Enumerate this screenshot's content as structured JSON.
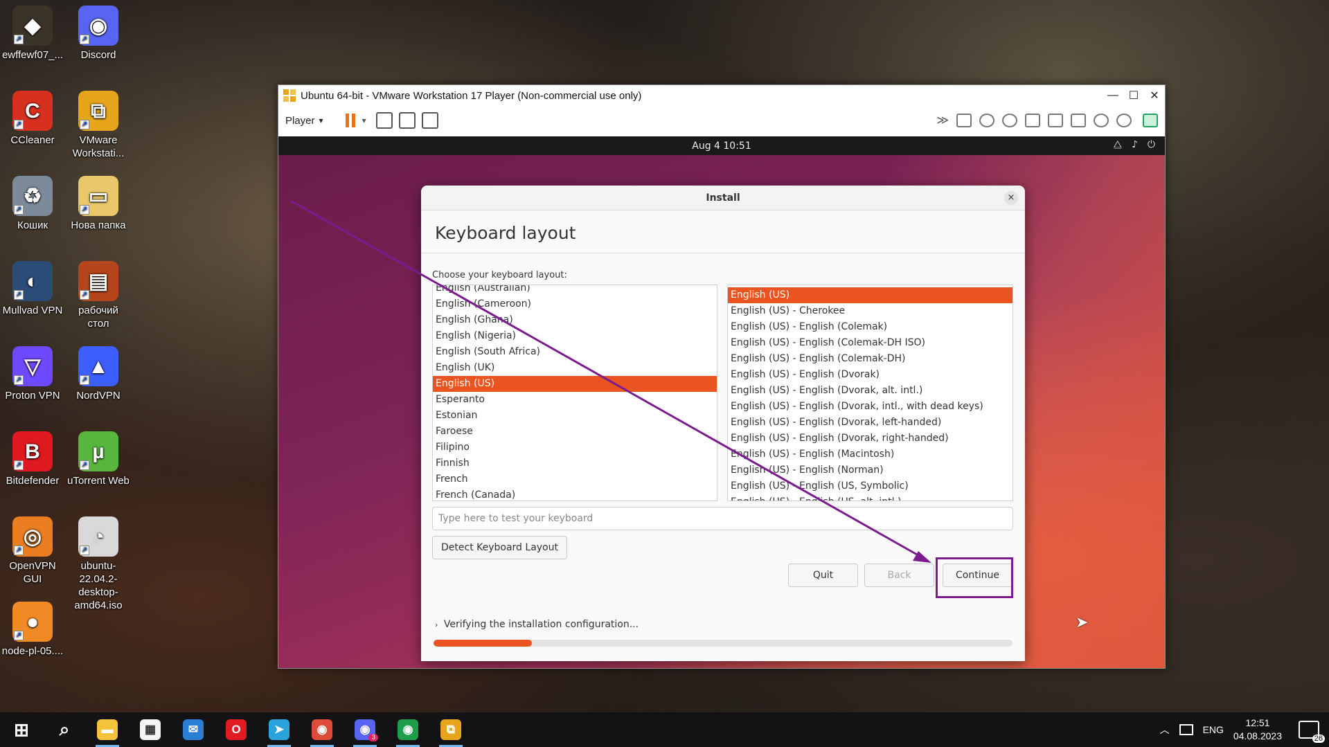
{
  "desktop": {
    "icons": [
      {
        "label": "ewffewf07_...",
        "glyph": "◆",
        "color": "#3a3328"
      },
      {
        "label": "Discord",
        "glyph": "◉",
        "color": "#5865f2"
      },
      {
        "label": "CCleaner",
        "glyph": "C",
        "color": "#d8301f"
      },
      {
        "label": "VMware Workstati...",
        "glyph": "⧉",
        "color": "#e7a51b"
      },
      {
        "label": "Кошик",
        "glyph": "♻",
        "color": "#7d8a99"
      },
      {
        "label": "Нова папка",
        "glyph": "▭",
        "color": "#e8c86a"
      },
      {
        "label": "Mullvad VPN",
        "glyph": "◐",
        "color": "#2b4b78"
      },
      {
        "label": "рабочий стол",
        "glyph": "▤",
        "color": "#b5451b"
      },
      {
        "label": "Proton VPN",
        "glyph": "▽",
        "color": "#6d4aff"
      },
      {
        "label": "NordVPN",
        "glyph": "▲",
        "color": "#3e5fff"
      },
      {
        "label": "Bitdefender",
        "glyph": "B",
        "color": "#e0181f"
      },
      {
        "label": "uTorrent Web",
        "glyph": "µ",
        "color": "#58b63e"
      },
      {
        "label": "OpenVPN GUI",
        "glyph": "◎",
        "color": "#ea7e20"
      },
      {
        "label": "ubuntu-22.04.2-desktop-amd64.iso",
        "glyph": "◔",
        "color": "#d9d9d9"
      },
      {
        "label": "node-pl-05....",
        "glyph": "●",
        "color": "#f08a24"
      }
    ]
  },
  "vmware": {
    "title": "Ubuntu 64-bit - VMware Workstation 17 Player (Non-commercial use only)",
    "minimize": "—",
    "maximize": "☐",
    "close": "✕",
    "player_label": "Player",
    "dropdown": "▾",
    "fast_forward": "≫"
  },
  "ubuntu": {
    "clock": "Aug 4  10:51",
    "tray": {
      "network": "⧋",
      "volume": "♪",
      "power": "⏻"
    }
  },
  "install": {
    "header": "Install",
    "close": "×",
    "title": "Keyboard layout",
    "choose_label": "Choose your keyboard layout:",
    "languages": [
      "English (Australian)",
      "English (Cameroon)",
      "English (Ghana)",
      "English (Nigeria)",
      "English (South Africa)",
      "English (UK)",
      "English (US)",
      "Esperanto",
      "Estonian",
      "Faroese",
      "Filipino",
      "Finnish",
      "French",
      "French (Canada)"
    ],
    "selected_language": "English (US)",
    "variants": [
      "English (US)",
      "English (US) - Cherokee",
      "English (US) - English (Colemak)",
      "English (US) - English (Colemak-DH ISO)",
      "English (US) - English (Colemak-DH)",
      "English (US) - English (Dvorak)",
      "English (US) - English (Dvorak, alt. intl.)",
      "English (US) - English (Dvorak, intl., with dead keys)",
      "English (US) - English (Dvorak, left-handed)",
      "English (US) - English (Dvorak, right-handed)",
      "English (US) - English (Macintosh)",
      "English (US) - English (Norman)",
      "English (US) - English (US, Symbolic)",
      "English (US) - English (US, alt. intl.)"
    ],
    "selected_variant": "English (US)",
    "test_placeholder": "Type here to test your keyboard",
    "detect_label": "Detect Keyboard Layout",
    "quit_label": "Quit",
    "back_label": "Back",
    "continue_label": "Continue",
    "verify_chevron": "›",
    "verify_text": "Verifying the installation configuration...",
    "progress": 0.17
  },
  "taskbar": {
    "apps": [
      {
        "name": "start",
        "glyph": "⊞",
        "color": "transparent"
      },
      {
        "name": "search",
        "glyph": "⌕",
        "color": "transparent"
      },
      {
        "name": "file-explorer",
        "glyph": "▬",
        "color": "#f3c33b"
      },
      {
        "name": "store",
        "glyph": "▦",
        "color": "#f5f5f5"
      },
      {
        "name": "mail",
        "glyph": "✉",
        "color": "#2a7fd4"
      },
      {
        "name": "opera",
        "glyph": "O",
        "color": "#e01b22"
      },
      {
        "name": "telegram",
        "glyph": "➤",
        "color": "#2aa3dc"
      },
      {
        "name": "chrome",
        "glyph": "◉",
        "color": "#dd4b39"
      },
      {
        "name": "discord",
        "glyph": "◉",
        "color": "#5865f2"
      },
      {
        "name": "chrome-profile",
        "glyph": "◉",
        "color": "#1e9e4a"
      },
      {
        "name": "vmware",
        "glyph": "⧉",
        "color": "#e7a51b"
      }
    ],
    "discord_badge": "3",
    "tray_up": "︿",
    "language": "ENG",
    "time": "12:51",
    "date": "04.08.2023",
    "notifications": "26"
  }
}
